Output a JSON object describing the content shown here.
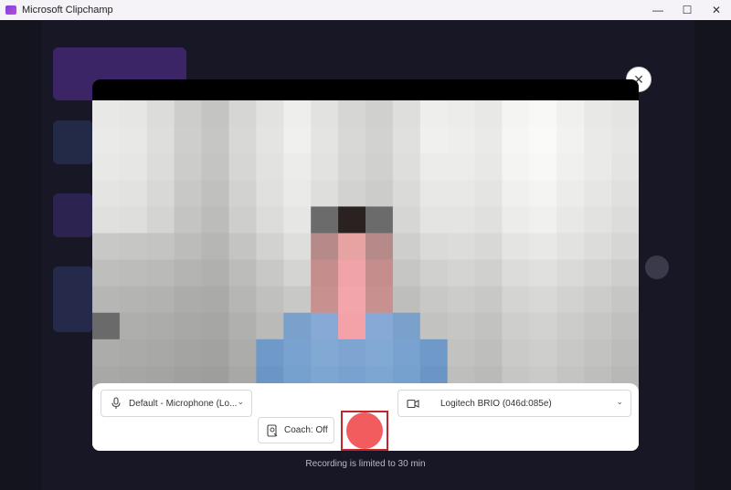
{
  "window": {
    "title": "Microsoft Clipchamp",
    "minimize_glyph": "—",
    "maximize_glyph": "☐",
    "close_glyph": "✕"
  },
  "dialog": {
    "close_glyph": "✕",
    "mic_select": {
      "value": "Default - Microphone (Lo...",
      "icon": "microphone-icon"
    },
    "camera_select": {
      "value": "Logitech BRIO (046d:085e)",
      "icon": "video-camera-icon"
    },
    "coach_button": {
      "label": "Coach: Off",
      "icon": "coach-icon"
    },
    "record_button": {
      "icon": "record-icon"
    },
    "limit_text": "Recording is limited to 30 min"
  },
  "colors": {
    "record": "#f25c5f",
    "record_outline": "#c0272d",
    "app_background": "#171725"
  }
}
